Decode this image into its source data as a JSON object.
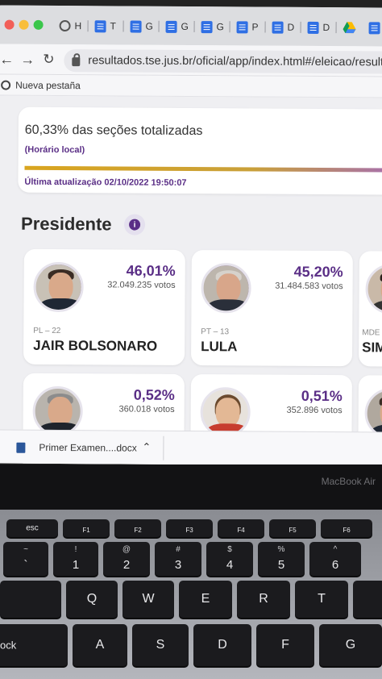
{
  "browser": {
    "tabs": [
      {
        "letter": "H",
        "icon": "globe-icon"
      },
      {
        "letter": "T",
        "icon": "docs-icon"
      },
      {
        "letter": "G",
        "icon": "docs-icon"
      },
      {
        "letter": "G",
        "icon": "docs-icon"
      },
      {
        "letter": "G",
        "icon": "docs-icon"
      },
      {
        "letter": "P",
        "icon": "docs-icon"
      },
      {
        "letter": "D",
        "icon": "docs-icon"
      },
      {
        "letter": "D",
        "icon": "docs-icon"
      }
    ],
    "url": "resultados.tse.jus.br/oficial/app/index.html#/eleicao/resultad",
    "bookmark": "Nueva pestaña"
  },
  "status": {
    "percent_text": "60,33% das seções totalizadas",
    "local_time": "(Horário local)",
    "progress": 0.6033,
    "last_update": "Última atualização 02/10/2022 19:50:07"
  },
  "section_title": "Presidente",
  "info_label": "i",
  "candidates": [
    {
      "percent": "46,01%",
      "votes": "32.049.235 votos",
      "party": "PL – 22",
      "name": "JAIR BOLSONARO",
      "arc": 0.4601
    },
    {
      "percent": "45,20%",
      "votes": "31.484.583 votos",
      "party": "PT – 13",
      "name": "LULA",
      "arc": 0.452
    },
    {
      "percent": "",
      "votes": "",
      "party": "MDE",
      "name": "SIM"
    },
    {
      "percent": "0,52%",
      "votes": "360.018 votos",
      "party": "",
      "name": ""
    },
    {
      "percent": "0,51%",
      "votes": "352.896 votos",
      "party": "",
      "name": ""
    }
  ],
  "download": {
    "filename": "Primer Examen....docx"
  },
  "laptop": {
    "brand": "MacBook Air"
  },
  "keyboard": {
    "fn_row": [
      "esc",
      "F1",
      "F2",
      "F3",
      "F4",
      "F5",
      "F6"
    ],
    "num_row": [
      {
        "top": "~",
        "bottom": "`"
      },
      {
        "top": "!",
        "bottom": "1"
      },
      {
        "top": "@",
        "bottom": "2"
      },
      {
        "top": "#",
        "bottom": "3"
      },
      {
        "top": "$",
        "bottom": "4"
      },
      {
        "top": "%",
        "bottom": "5"
      },
      {
        "top": "^",
        "bottom": "6"
      }
    ],
    "qwerty_row": [
      "Q",
      "W",
      "E",
      "R",
      "T"
    ],
    "asdf_row": [
      "A",
      "S",
      "D",
      "F",
      "G"
    ],
    "caps_label": "ock"
  }
}
